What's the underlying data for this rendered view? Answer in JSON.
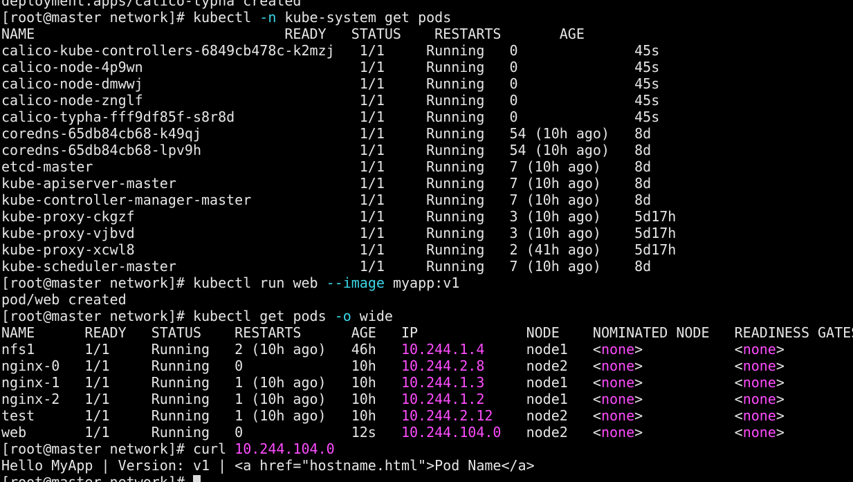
{
  "terminal": {
    "top_line": "deployment.apps/calico-typha created",
    "prompt": "[root@master network]# ",
    "cmd1": {
      "pre": "kubectl ",
      "flag": "-n",
      "post": " kube-system get pods"
    },
    "pods1_header": "NAME                              READY   STATUS    RESTARTS       AGE",
    "pods1_rows": [
      "calico-kube-controllers-6849cb478c-k2mzj   1/1     Running   0              45s",
      "calico-node-4p9wn                          1/1     Running   0              45s",
      "calico-node-dmwwj                          1/1     Running   0              45s",
      "calico-node-znglf                          1/1     Running   0              45s",
      "calico-typha-fff9df85f-s8r8d               1/1     Running   0              45s",
      "coredns-65db84cb68-k49qj                   1/1     Running   54 (10h ago)   8d",
      "coredns-65db84cb68-lpv9h                   1/1     Running   54 (10h ago)   8d",
      "etcd-master                                1/1     Running   7 (10h ago)    8d",
      "kube-apiserver-master                      1/1     Running   7 (10h ago)    8d",
      "kube-controller-manager-master             1/1     Running   7 (10h ago)    8d",
      "kube-proxy-ckgzf                           1/1     Running   3 (10h ago)    5d17h",
      "kube-proxy-vjbvd                           1/1     Running   3 (10h ago)    5d17h",
      "kube-proxy-xcwl8                           1/1     Running   2 (41h ago)    5d17h",
      "kube-scheduler-master                      1/1     Running   7 (10h ago)    8d"
    ],
    "cmd2": {
      "pre": "kubectl run web ",
      "flag": "--image",
      "post": " myapp:v1"
    },
    "cmd2_output": "pod/web created",
    "cmd3": {
      "pre": "kubectl get pods ",
      "flag": "-o",
      "post": " wide"
    },
    "pods2_header": "NAME      READY   STATUS    RESTARTS      AGE   IP             NODE    NOMINATED NODE   READINESS GATES",
    "pods2_rows": [
      {
        "pre": "nfs1      1/1     Running   2 (10h ago)   46h   ",
        "ip": "10.244.1.4  ",
        "mid": "   node1   <",
        "n1": "none",
        "gap": ">           <",
        "n2": "none",
        "end": ">"
      },
      {
        "pre": "nginx-0   1/1     Running   0             10h   ",
        "ip": "10.244.2.8  ",
        "mid": "   node2   <",
        "n1": "none",
        "gap": ">           <",
        "n2": "none",
        "end": ">"
      },
      {
        "pre": "nginx-1   1/1     Running   1 (10h ago)   10h   ",
        "ip": "10.244.1.3  ",
        "mid": "   node1   <",
        "n1": "none",
        "gap": ">           <",
        "n2": "none",
        "end": ">"
      },
      {
        "pre": "nginx-2   1/1     Running   1 (10h ago)   10h   ",
        "ip": "10.244.1.2  ",
        "mid": "   node1   <",
        "n1": "none",
        "gap": ">           <",
        "n2": "none",
        "end": ">"
      },
      {
        "pre": "test      1/1     Running   1 (10h ago)   10h   ",
        "ip": "10.244.2.12 ",
        "mid": "   node2   <",
        "n1": "none",
        "gap": ">           <",
        "n2": "none",
        "end": ">"
      },
      {
        "pre": "web       1/1     Running   0             12s   ",
        "ip": "10.244.104.0",
        "mid": "   node2   <",
        "n1": "none",
        "gap": ">           <",
        "n2": "none",
        "end": ">"
      }
    ],
    "cmd4": {
      "pre": "curl ",
      "ip": "10.244.104.0"
    },
    "cmd4_output": "Hello MyApp | Version: v1 | <a href=\"hostname.html\">Pod Name</a>",
    "colors": {
      "background": "#000000",
      "text": "#e6e6e6",
      "flag": "#3ad6e6",
      "ip": "#ff4dff"
    }
  }
}
